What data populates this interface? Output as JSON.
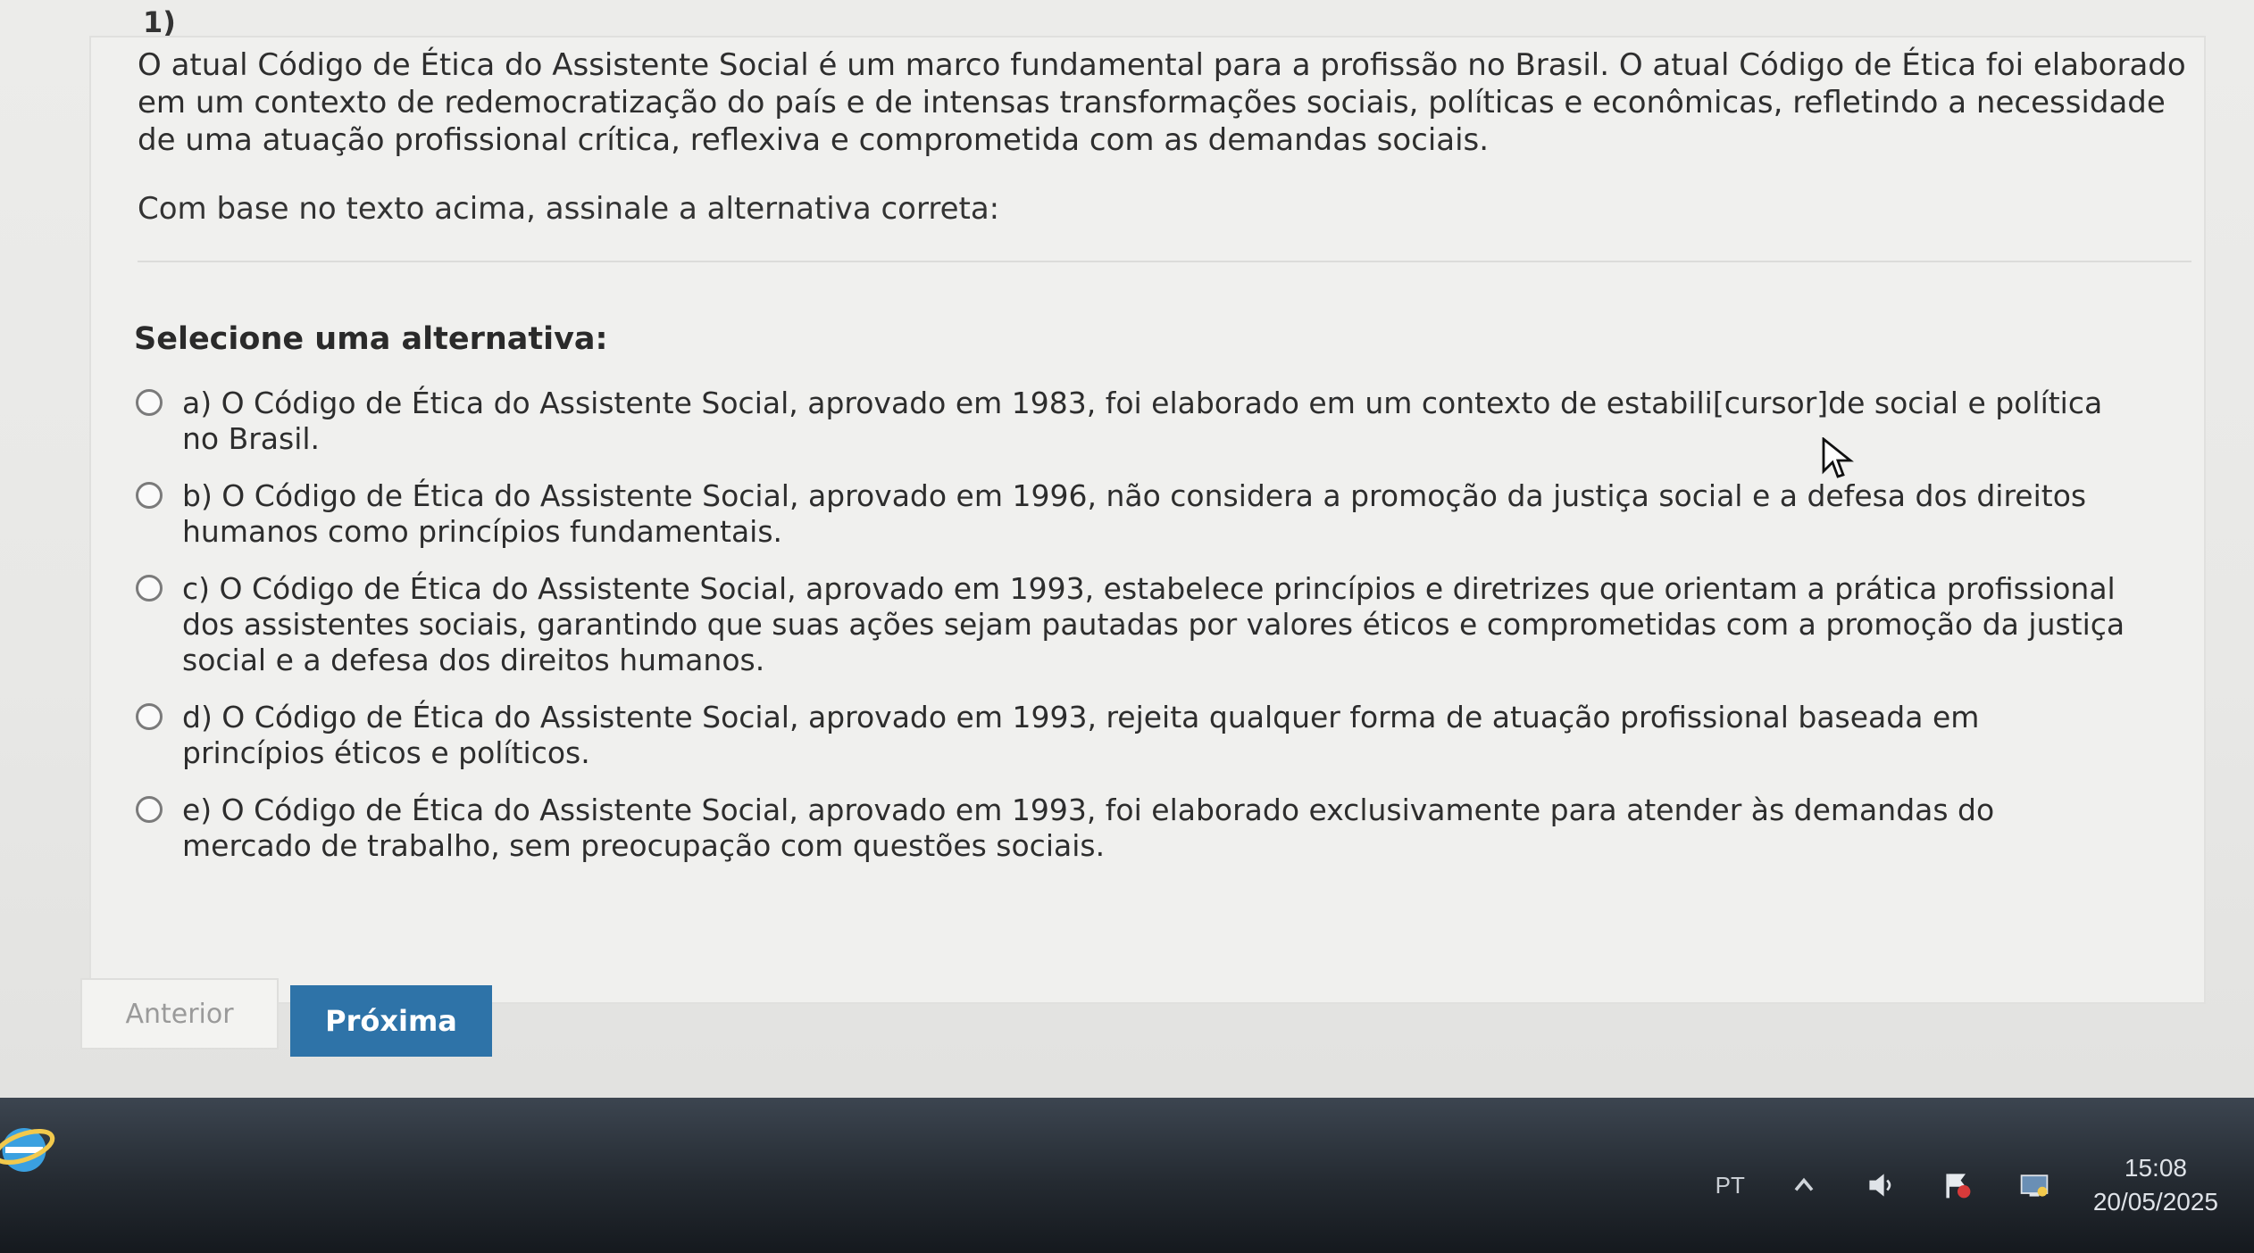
{
  "question": {
    "number": "1)",
    "statement": "O atual Código de Ética do Assistente Social é um marco fundamental para a profissão no Brasil. O atual Código de Ética foi elaborado em um contexto de redemocratização do país e de intensas transformações sociais, políticas e econômicas, refletindo a necessidade de uma atuação profissional crítica, reflexiva e comprometida com as demandas sociais.",
    "instruction": "Com base no texto acima, assinale a alternativa correta:",
    "select_label": "Selecione uma alternativa:",
    "options": [
      {
        "text": "a) O Código de Ética do Assistente Social, aprovado em 1983, foi elaborado em um contexto de estabili[cursor]de social e política no Brasil."
      },
      {
        "text": "b) O Código de Ética do Assistente Social, aprovado em 1996, não considera a promoção da justiça social e a defesa dos direitos humanos como princípios fundamentais."
      },
      {
        "text": "c) O Código de Ética do Assistente Social, aprovado em 1993, estabelece princípios e diretrizes que orientam a prática profissional dos assistentes sociais, garantindo que suas ações sejam pautadas por valores éticos e comprometidas com a promoção da justiça social e a defesa dos direitos humanos."
      },
      {
        "text": "d) O Código de Ética do Assistente Social, aprovado em 1993, rejeita qualquer forma de atuação profissional baseada em princípios éticos e políticos."
      },
      {
        "text": "e) O Código de Ética do Assistente Social, aprovado em 1993, foi elaborado exclusivamente para atender às demandas do mercado de trabalho, sem preocupação com questões sociais."
      }
    ]
  },
  "navigation": {
    "prev_label": "Anterior",
    "next_label": "Próxima"
  },
  "taskbar": {
    "language": "PT",
    "time": "15:08",
    "date": "20/05/2025"
  },
  "colors": {
    "next_button": "#2e73a8",
    "page_background": "#e9e9e7",
    "taskbar": "#242a31"
  }
}
